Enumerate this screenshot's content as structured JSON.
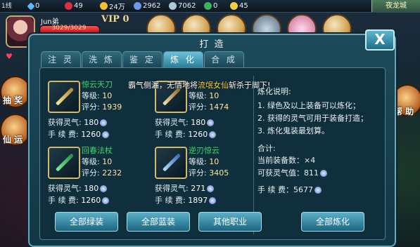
{
  "topbar": {
    "line": "1线",
    "diamonds": "0",
    "red_gems": "49",
    "gold": "24万",
    "blue_coin": "2962",
    "honor": "7062",
    "green_coin": "0",
    "moon": "45",
    "city": "夜龙城"
  },
  "player": {
    "name": "Jun弟",
    "vip": "VIP 0",
    "hp": "3029/3029",
    "hp_fraction": 1.0,
    "level_hint": "3"
  },
  "side": {
    "lottery": "抽 奖",
    "fortune": "仙 运",
    "help": "帮 助"
  },
  "panel": {
    "title": "打 造",
    "close": "X",
    "tabs": [
      "注 灵",
      "洗 炼",
      "鉴 定",
      "炼 化",
      "合 成"
    ],
    "active_tab": 3
  },
  "items": [
    {
      "name": "惊云天刀",
      "level_label": "等级:",
      "level": "10",
      "score_label": "评分:",
      "score": "1939",
      "gain_label": "获得灵气:",
      "gain": "180",
      "fee_label": "手 续 费:",
      "fee": "1260"
    },
    {
      "name": "",
      "level_label": "等级:",
      "level": "10",
      "score_label": "评分:",
      "score": "1474",
      "gain_label": "获得灵气:",
      "gain": "180",
      "fee_label": "手 续 费:",
      "fee": "1260"
    },
    {
      "name": "回春法杖",
      "level_label": "等级:",
      "level": "10",
      "score_label": "评分:",
      "score": "2232",
      "gain_label": "获得灵气:",
      "gain": "180",
      "fee_label": "手 续 费:",
      "fee": "1260"
    },
    {
      "name": "逆刃惊云",
      "level_label": "等级:",
      "level": "10",
      "score_label": "评分:",
      "score": "3405",
      "gain_label": "获得灵气:",
      "gain": "271",
      "fee_label": "手 续 费:",
      "fee": "1897"
    }
  ],
  "marquee": {
    "prefix": "霸气侧漏，无情地将",
    "highlight": "流氓女仙",
    "suffix": "斩杀于脚下!"
  },
  "rules": {
    "title": "炼化说明:",
    "lines": [
      "1. 绿色及以上装备可以炼化；",
      "2. 获得的灵气可用于装备打造；",
      "3. 炼化鬼装最划算。"
    ],
    "total_label": "合计:",
    "equip_count_label": "当前装备数：",
    "equip_count": "×4",
    "gain_label": "可获灵气值：",
    "gain": "811",
    "fee_label": "手 续 费：",
    "fee": "5677"
  },
  "buttons": {
    "all_green": "全部绿装",
    "all_blue": "全部蓝装",
    "other_class": "其他职业",
    "refine_all": "全部炼化"
  },
  "colors": {
    "item_name": "#3fd56a",
    "panel": "#1d4a5a",
    "highlight": "#ffd040"
  }
}
